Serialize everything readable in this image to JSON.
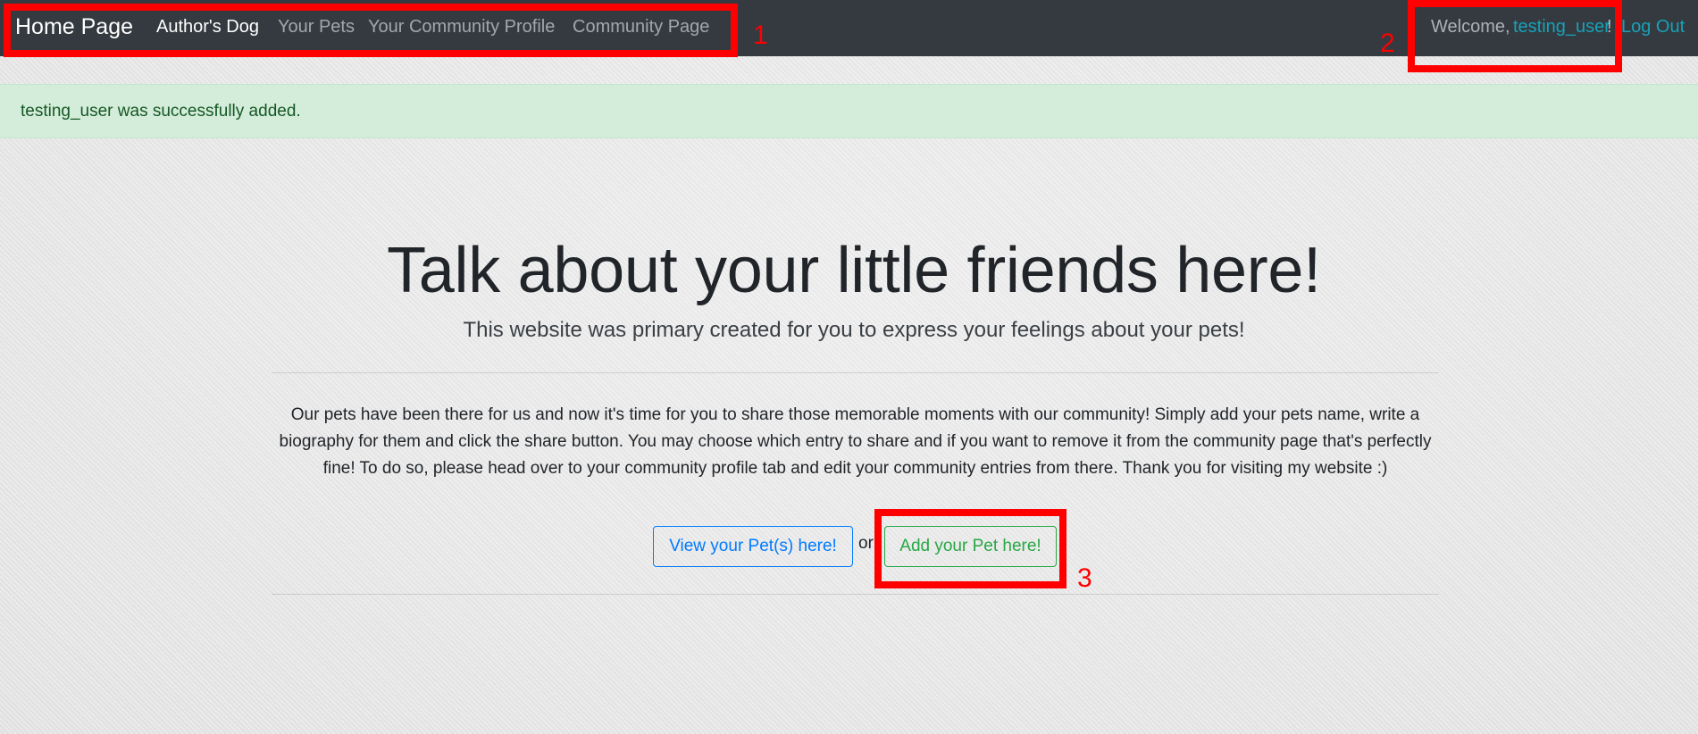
{
  "navbar": {
    "brand": "Home Page",
    "links": [
      {
        "label": "Author's Dog",
        "active": true
      },
      {
        "label": "Your Pets",
        "active": false
      },
      {
        "label": "Your Community Profile",
        "active": false
      },
      {
        "label": "Community Page",
        "active": false
      }
    ],
    "welcome_prefix": "Welcome, ",
    "username": "testing_user",
    "welcome_suffix": "!",
    "logout_label": "Log Out"
  },
  "alert": {
    "message": "testing_user was successfully added."
  },
  "jumbotron": {
    "title": "Talk about your little friends here!",
    "lead": "This website was primary created for you to express your feelings about your pets!",
    "body": "Our pets have been there for us and now it's time for you to share those memorable moments with our community! Simply add your pets name, write a biography for them and click the share button. You may choose which entry to share and if you want to remove it from the community page that's perfectly fine! To do so, please head over to your community profile tab and edit your community entries from there. Thank you for visiting my website :)",
    "view_button": "View your Pet(s) here!",
    "or_text": "or",
    "add_button": "Add your Pet here!"
  },
  "annotations": [
    "1",
    "2",
    "3"
  ],
  "colors": {
    "navbar_bg": "#343a40",
    "alert_bg": "#d4edda",
    "alert_text": "#155724",
    "primary": "#007bff",
    "success": "#28a745",
    "info": "#17a2b8",
    "annotation": "#ff0000"
  }
}
